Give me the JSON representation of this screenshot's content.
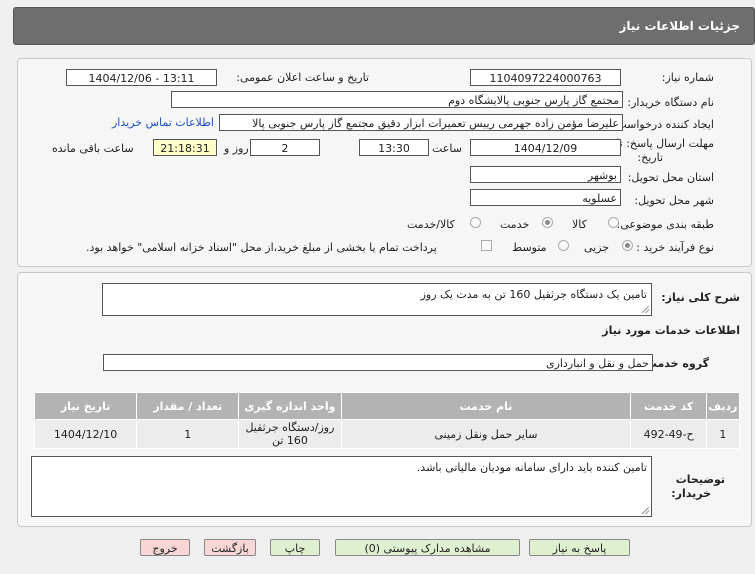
{
  "header": {
    "title": "جزئیات اطلاعات نیاز"
  },
  "form": {
    "need_number_label": "شماره نیاز:",
    "need_number": "1104097224000763",
    "announce_label": "تاریخ و ساعت اعلان عمومی:",
    "announce_value": "1404/12/06 - 13:11",
    "buyer_label": "نام دستگاه خریدار:",
    "buyer_value": "مجتمع گاز پارس جنوبی  پالایشگاه دوم",
    "creator_label": "ایجاد کننده درخواست:",
    "creator_value": "علیرضا مؤمن زاده جهرمی رییس تعمیرات ابزار دقیق مجتمع گاز پارس جنوبی  پالا",
    "contact_link": "اطلاعات تماس خریدار",
    "deadline_label_1": "مهلت ارسال پاسخ: تا",
    "deadline_label_2": "تاریخ:",
    "deadline_date": "1404/12/09",
    "time_label": "ساعت",
    "deadline_time": "13:30",
    "days_value": "2",
    "days_label": "روز و",
    "remaining_value": "21:18:31",
    "remaining_label": "ساعت باقی مانده",
    "province_label": "استان محل تحویل:",
    "province_value": "بوشهر",
    "city_label": "شهر محل تحویل:",
    "city_value": "عسلویه",
    "category_label": "طبقه بندی موضوعی:",
    "category_options": [
      "کالا",
      "خدمت",
      "کالا/خدمت"
    ],
    "category_selected": "خدمت",
    "purchase_label": "نوع فرآیند خرید :",
    "purchase_options": [
      "جزیی",
      "متوسط"
    ],
    "purchase_selected": "جزیی",
    "payment_note": "پرداخت تمام یا بخشی از مبلغ خرید،از محل \"اسناد خزانه اسلامی\" خواهد بود."
  },
  "details": {
    "description_label": "شرح کلی نیاز:",
    "description_value": "تامین یک دستگاه جرثقیل 160 تن به مدت یک روز",
    "services_heading": "اطلاعات خدمات مورد نیاز",
    "service_group_label": "گروه خدمت:",
    "service_group_value": "حمل و نقل و انبارداری",
    "table": {
      "headers": [
        "ردیف",
        "کد خدمت",
        "نام خدمت",
        "واحد اندازه گیری",
        "تعداد / مقدار",
        "تاریخ نیاز"
      ],
      "rows": [
        {
          "row": "1",
          "code": "ح-49-492",
          "name": "سایر حمل ونقل زمینی",
          "unit_1": "روز/دستگاه جرثقیل",
          "unit_2": "160 تن",
          "qty": "1",
          "date": "1404/12/10"
        }
      ]
    },
    "notes_label_1": "توضیحات",
    "notes_label_2": "خریدار:",
    "notes_value": "تامین کننده باید دارای سامانه مودیان مالیاتی باشد."
  },
  "buttons": {
    "reply": "پاسخ به نیاز",
    "attachments": "مشاهده مدارک پیوستی (0)",
    "print": "چاپ",
    "back": "بازگشت",
    "exit": "خروج"
  }
}
